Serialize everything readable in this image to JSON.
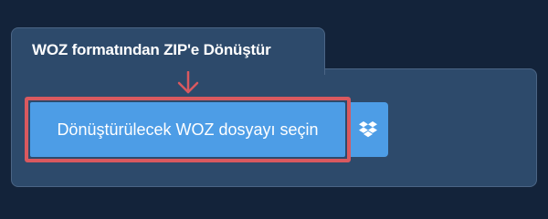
{
  "tab": {
    "title": "WOZ formatından ZIP'e Dönüştür"
  },
  "upload": {
    "choose_label": "Dönüştürülecek WOZ dosyayı seçin",
    "dropbox_icon": "dropbox-icon"
  },
  "colors": {
    "page_bg": "#13233a",
    "panel_bg": "#2d4a6b",
    "button_bg": "#4d9de6",
    "highlight": "#d9595f"
  }
}
